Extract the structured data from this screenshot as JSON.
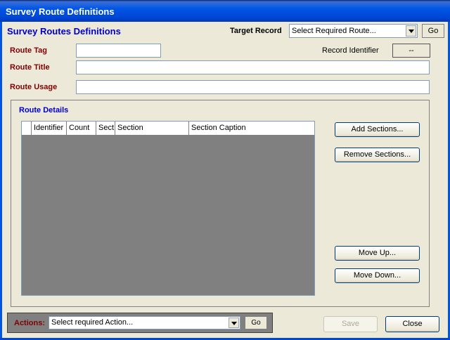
{
  "window": {
    "title": "Survey Route Definitions"
  },
  "header": {
    "heading": "Survey Routes Definitions",
    "target_record_label": "Target Record",
    "target_record_value": "Select Required Route...",
    "go_label": "Go"
  },
  "form": {
    "route_tag_label": "Route Tag",
    "route_tag_value": "",
    "record_identifier_label": "Record Identifier",
    "record_identifier_value": "--",
    "route_title_label": "Route Title",
    "route_title_value": "",
    "route_usage_label": "Route Usage",
    "route_usage_value": ""
  },
  "route_details": {
    "title": "Route Details",
    "columns": [
      "",
      "Identifier",
      "Count",
      "Sect",
      "Section",
      "Section Caption"
    ],
    "rows": [],
    "buttons": {
      "add_sections": "Add Sections...",
      "remove_sections": "Remove Sections...",
      "move_up": "Move Up...",
      "move_down": "Move Down..."
    }
  },
  "actions": {
    "label": "Actions:",
    "value": "Select required Action...",
    "go_label": "Go"
  },
  "footer": {
    "save_label": "Save",
    "close_label": "Close"
  }
}
